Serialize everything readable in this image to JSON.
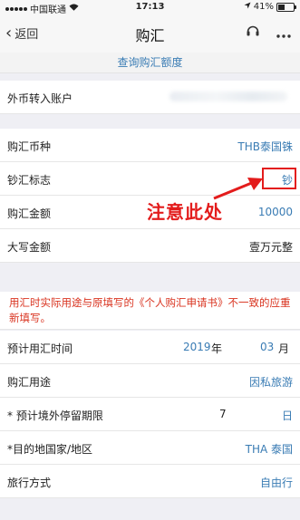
{
  "status_bar": {
    "carrier": "中国联通",
    "time": "17:13",
    "battery": "41%",
    "battery_level": 0.41
  },
  "nav": {
    "back_label": "返回",
    "title": "购汇"
  },
  "subhead": {
    "label": "查询购汇额度"
  },
  "account": {
    "label": "外币转入账户"
  },
  "currency": {
    "label": "购汇币种",
    "value": "THB泰国铢"
  },
  "cash_flag": {
    "label": "钞汇标志",
    "value": "钞"
  },
  "amount": {
    "label": "购汇金额",
    "value": "10000"
  },
  "amount_words": {
    "label": "大写金额",
    "value": "壹万元整"
  },
  "notice": {
    "text": "用汇时实际用途与原填写的《个人购汇申请书》不一致的应重新填写。"
  },
  "expected_time": {
    "label": "预计用汇时间",
    "year": "2019",
    "year_suffix": "年",
    "month": "03",
    "month_suffix": "月"
  },
  "purpose": {
    "label": "购汇用途",
    "value": "因私旅游"
  },
  "stay": {
    "label": "* 预计境外停留期限",
    "days": "7",
    "unit": "日"
  },
  "destination": {
    "label": "*目的地国家/地区",
    "value": "THA 泰国"
  },
  "travel": {
    "label": "旅行方式",
    "value": "自由行"
  },
  "annotation": {
    "text": "注意此处",
    "color": "#e31c1c"
  },
  "colors": {
    "link_blue": "#3a7cb4",
    "notice_red": "#d9331f"
  }
}
